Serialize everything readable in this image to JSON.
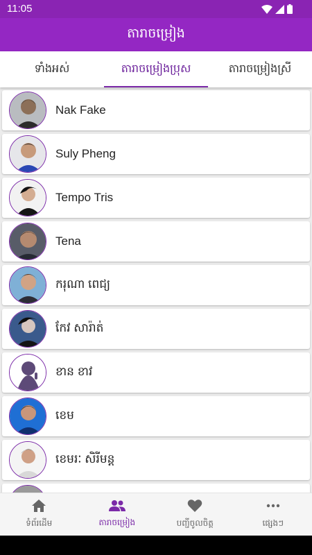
{
  "status": {
    "time": "11:05"
  },
  "app": {
    "title": "តារាចម្រៀង"
  },
  "tabs": [
    {
      "label": "ទាំងអស់"
    },
    {
      "label": "តារាចម្រៀងប្រុស"
    },
    {
      "label": "តារាចម្រៀងស្រី"
    }
  ],
  "artists": [
    {
      "name": "Nak Fake"
    },
    {
      "name": "Suly Pheng"
    },
    {
      "name": "Tempo Tris"
    },
    {
      "name": "Tena"
    },
    {
      "name": "ករុណា ពេជ្យ"
    },
    {
      "name": "កែវ សារ៉ាត់"
    },
    {
      "name": "ខាន ខាវ"
    },
    {
      "name": "ខេម"
    },
    {
      "name": "ខេមរៈ សិរីមន្ត"
    }
  ],
  "bottom_nav": [
    {
      "label": "ទំព័រដើម",
      "icon": "home-icon"
    },
    {
      "label": "តារាចម្រៀង",
      "icon": "people-icon"
    },
    {
      "label": "បញ្ជីចូលចិត្ត",
      "icon": "heart-icon"
    },
    {
      "label": "ផ្សេងៗ",
      "icon": "more-icon"
    }
  ],
  "colors": {
    "primary": "#9427c3",
    "status_bar": "#8a24b3",
    "accent": "#7b2aa8"
  }
}
